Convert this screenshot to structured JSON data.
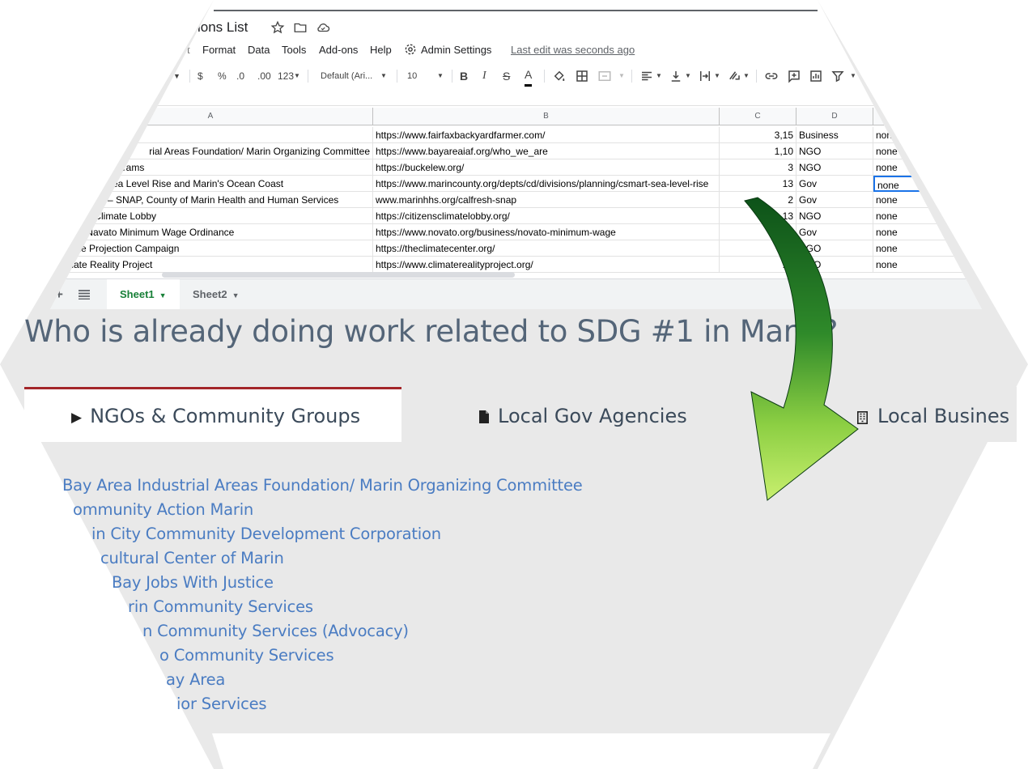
{
  "sheet": {
    "title": "ions List",
    "menu": [
      "Format",
      "Data",
      "Tools",
      "Add-ons",
      "Help",
      "Admin Settings"
    ],
    "menu_cut": "t",
    "last_edit": "Last edit was seconds ago",
    "toolbar": {
      "currency": "$",
      "percent": "%",
      "dec_less": ".0",
      "dec_more": ".00",
      "number_format": "123",
      "font": "Default (Ari...",
      "font_size": "10",
      "bold": "B",
      "italic": "I",
      "strike": "S",
      "text_color": "A"
    },
    "formula_fragment": "s",
    "columns": [
      "A",
      "B",
      "C",
      "D"
    ],
    "rows": [
      {
        "a": "",
        "b": "https://www.fairfaxbackyardfarmer.com/",
        "c": "3,15",
        "d": "Business",
        "e": "non."
      },
      {
        "a": "rial Areas Foundation/ Marin Organizing Committee",
        "b": "https://www.bayareaiaf.org/who_we_are",
        "c": "1,10",
        "d": "NGO",
        "e": "none"
      },
      {
        "a": "grams",
        "b": "https://buckelew.org/",
        "c": "3",
        "d": "NGO",
        "e": "none"
      },
      {
        "a": "Sea Level Rise and Marin's Ocean Coast",
        "b": "https://www.marincounty.org/depts/cd/divisions/planning/csmart-sea-level-rise",
        "c": "13",
        "d": "Gov",
        "e": "none"
      },
      {
        "a": "– SNAP, County of Marin Health and Human Services",
        "b": "www.marinhhs.org/calfresh-snap",
        "c": "2",
        "d": "Gov",
        "e": "none"
      },
      {
        "a": "s Climate Lobby",
        "b": "https://citizensclimatelobby.org/",
        "c": "13",
        "d": "NGO",
        "e": "none"
      },
      {
        "a": "of Navato Minimum Wage Ordinance",
        "b": "https://www.novato.org/business/novato-minimum-wage",
        "c": "1",
        "d": "Gov",
        "e": "none"
      },
      {
        "a": "mate Projection Campaign",
        "b": "https://theclimatecenter.org/",
        "c": "",
        "d": "NGO",
        "e": "none"
      },
      {
        "a": "Climate Reality Project",
        "b": "https://www.climaterealityproject.org/",
        "c": "13",
        "d": "NGO",
        "e": "none"
      }
    ],
    "sheet_tabs": [
      "Sheet1",
      "Sheet2"
    ],
    "add_sheet_icon": "plus-icon",
    "all_sheets_icon": "list-icon"
  },
  "site": {
    "question": "Who is already doing work related to SDG #1 in Marin?",
    "tabs": [
      {
        "label": "NGOs & Community Groups",
        "icon": "▶"
      },
      {
        "label": "Local Gov Agencies",
        "icon": "■"
      },
      {
        "label": "Local Busines",
        "icon": "▦"
      }
    ],
    "list": [
      "Bay Area Industrial Areas Foundation/ Marin Organizing Committee",
      "ommunity Action Marin",
      "in City Community Development Corporation",
      "cultural Center of Marin",
      "Bay Jobs With Justice",
      "rin Community Services",
      "n Community Services (Advocacy)",
      "o Community Services",
      "ay Area",
      "ior Services"
    ]
  },
  "colors": {
    "accent": "#a3262a",
    "link": "#4a7cc2",
    "heading": "#546578",
    "sheet_green": "#188038",
    "arrow_dark": "#0f5a1e",
    "arrow_light": "#b7e55a"
  }
}
